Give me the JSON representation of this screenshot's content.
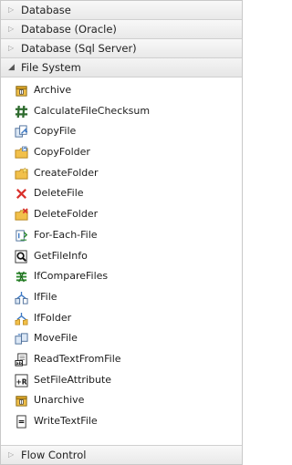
{
  "toolbox": {
    "groups_top": [
      {
        "label": "Database",
        "expanded": false
      },
      {
        "label": "Database (Oracle)",
        "expanded": false
      },
      {
        "label": "Database (Sql Server)",
        "expanded": false
      }
    ],
    "file_system": {
      "label": "File System",
      "expanded": true,
      "items": [
        {
          "label": "Archive",
          "icon": "archive-icon"
        },
        {
          "label": "CalculateFileChecksum",
          "icon": "checksum-icon"
        },
        {
          "label": "CopyFile",
          "icon": "copy-file-icon"
        },
        {
          "label": "CopyFolder",
          "icon": "copy-folder-icon"
        },
        {
          "label": "CreateFolder",
          "icon": "create-folder-icon"
        },
        {
          "label": "DeleteFile",
          "icon": "delete-file-icon"
        },
        {
          "label": "DeleteFolder",
          "icon": "delete-folder-icon"
        },
        {
          "label": "For-Each-File",
          "icon": "for-each-file-icon"
        },
        {
          "label": "GetFileInfo",
          "icon": "file-info-icon"
        },
        {
          "label": "IfCompareFiles",
          "icon": "compare-files-icon"
        },
        {
          "label": "IfFile",
          "icon": "if-file-icon"
        },
        {
          "label": "IfFolder",
          "icon": "if-folder-icon"
        },
        {
          "label": "MoveFile",
          "icon": "move-file-icon"
        },
        {
          "label": "ReadTextFromFile",
          "icon": "read-text-icon"
        },
        {
          "label": "SetFileAttribute",
          "icon": "set-attribute-icon"
        },
        {
          "label": "Unarchive",
          "icon": "unarchive-icon"
        },
        {
          "label": "WriteTextFile",
          "icon": "write-text-icon"
        }
      ]
    },
    "groups_bottom": [
      {
        "label": "Flow Control",
        "expanded": false
      }
    ]
  },
  "colors": {
    "folder": "#f2c04a",
    "folder_dark": "#c8911e",
    "page": "#ffffff",
    "page_border": "#6d7f96",
    "blue": "#3b78c4",
    "green": "#2e8b2e",
    "red": "#d9302b",
    "dark": "#333333"
  }
}
